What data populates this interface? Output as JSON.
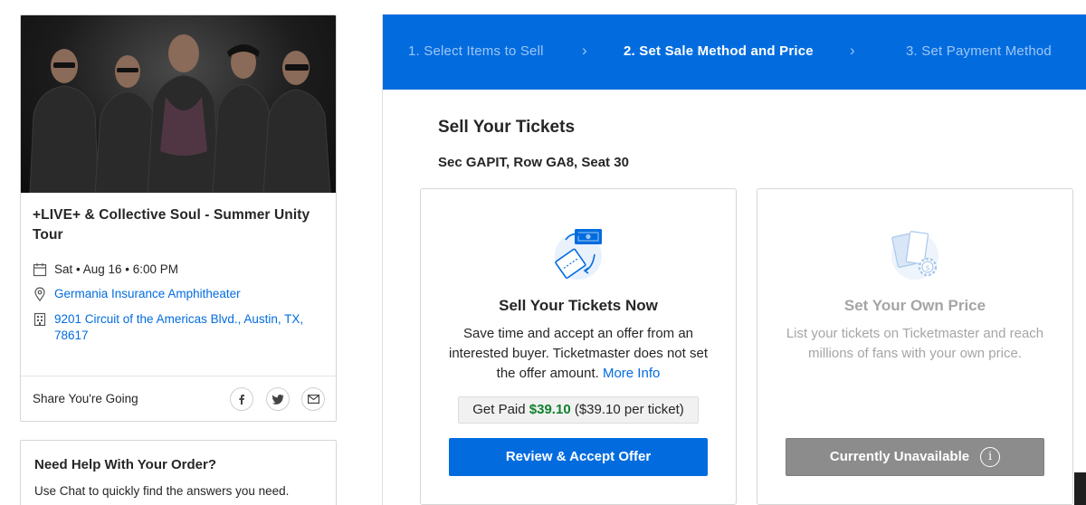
{
  "event": {
    "title": "+LIVE+ & Collective Soul - Summer Unity Tour",
    "date_time": "Sat • Aug 16 • 6:00 PM",
    "venue": "Germania Insurance Amphitheater",
    "address": "9201 Circuit of the Americas Blvd., Austin, TX, 78617",
    "share_label": "Share You're Going",
    "share_icons": [
      "facebook-icon",
      "twitter-icon",
      "email-icon"
    ]
  },
  "help": {
    "title": "Need Help With Your Order?",
    "text": "Use Chat to quickly find the answers you need."
  },
  "stepper": {
    "steps": [
      {
        "label": "1. Select Items to Sell",
        "active": false
      },
      {
        "label": "2. Set Sale Method and Price",
        "active": true
      },
      {
        "label": "3. Set Payment Method",
        "active": false
      }
    ]
  },
  "main": {
    "heading": "Sell Your Tickets",
    "seat": "Sec GAPIT, Row GA8, Seat 30"
  },
  "options": {
    "now": {
      "title": "Sell Your Tickets Now",
      "desc": "Save time and accept an offer from an interested buyer. Ticketmaster does not set the offer amount.",
      "more_info": "More Info",
      "get_paid_label": "Get Paid",
      "get_paid_amount": "$39.10",
      "get_paid_per": "($39.10 per ticket)",
      "button": "Review & Accept Offer"
    },
    "own": {
      "title": "Set Your Own Price",
      "desc": "List your tickets on Ticketmaster and reach millions of fans with your own price.",
      "button": "Currently Unavailable",
      "info_glyph": "i"
    }
  },
  "colors": {
    "brand_blue": "#026cdf",
    "paid_green": "#11812e",
    "disabled_gray": "#8c8c8c"
  }
}
